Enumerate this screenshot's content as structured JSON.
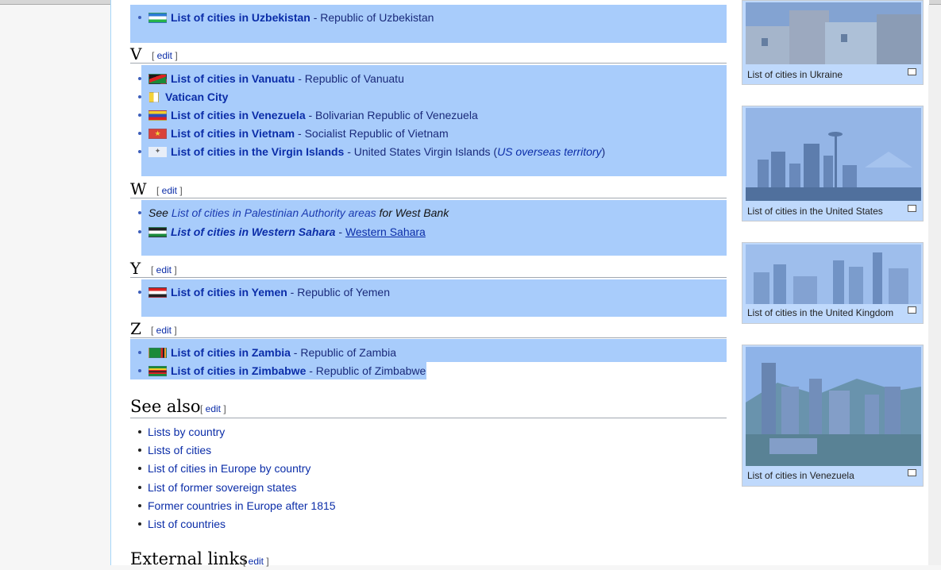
{
  "sections": {
    "u_tail": {
      "items": [
        {
          "title": "List of cities in Uzbekistan",
          "desc": " - Republic of Uzbekistan"
        }
      ]
    },
    "v": {
      "letter": "V",
      "edit": "edit",
      "items": [
        {
          "title": "List of cities in Vanuatu",
          "desc": " - Republic of Vanuatu"
        },
        {
          "title": "Vatican City",
          "desc": ""
        },
        {
          "title": "List of cities in Venezuela",
          "desc": " - Bolivarian Republic of Venezuela"
        },
        {
          "title": "List of cities in Vietnam",
          "desc": " - Socialist Republic of Vietnam"
        },
        {
          "title": "List of cities in the Virgin Islands",
          "desc": " - United States Virgin Islands (",
          "desc_italic": "US overseas territory",
          "desc_end": ")"
        }
      ]
    },
    "w": {
      "letter": "W",
      "edit": "edit",
      "see_prefix": "See ",
      "see_link": "List of cities in Palestinian Authority areas",
      "see_suffix": " for West Bank",
      "item_title": "List of cities in Western Sahara",
      "item_sep": " - ",
      "item_link": "Western Sahara"
    },
    "y": {
      "letter": "Y",
      "edit": "edit",
      "items": [
        {
          "title": "List of cities in Yemen",
          "desc": " - Republic of Yemen"
        }
      ]
    },
    "z": {
      "letter": "Z",
      "edit": "edit",
      "items": [
        {
          "title": "List of cities in Zambia",
          "desc": " - Republic of Zambia"
        },
        {
          "title": "List of cities in Zimbabwe",
          "desc": " - Republic of Zimbabwe"
        }
      ]
    }
  },
  "see_also": {
    "heading": "See also",
    "edit": "edit",
    "items": [
      "Lists by country",
      "Lists of cities",
      "List of cities in Europe by country",
      "List of former sovereign states",
      "Former countries in Europe after 1815",
      "List of countries"
    ]
  },
  "external_links": {
    "heading": "External links",
    "edit": "edit"
  },
  "thumbnails": [
    {
      "caption": "List of cities in Ukraine"
    },
    {
      "caption": "List of cities in the United States"
    },
    {
      "caption": "List of cities in the United Kingdom"
    },
    {
      "caption": "List of cities in Venezuela"
    }
  ],
  "colors": {
    "link": "#0b2da8",
    "selection": "#a8ccfb",
    "border": "#a7d7f9"
  }
}
